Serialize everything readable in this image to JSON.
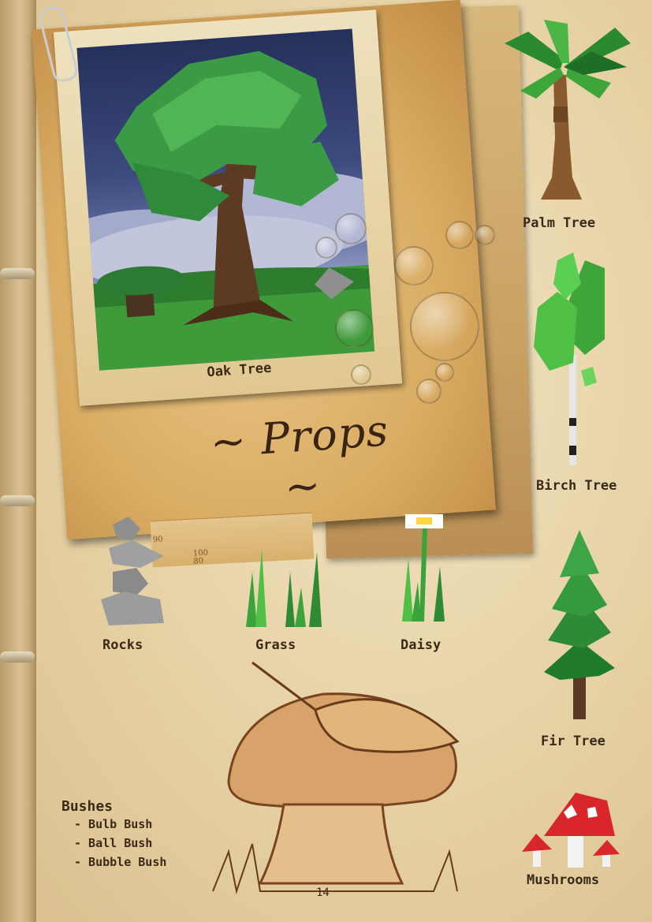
{
  "page": {
    "title": "~ Props ~",
    "page_number": "14"
  },
  "photo": {
    "caption": "Oak Tree"
  },
  "ruler": {
    "marks": [
      "90",
      "100",
      "80"
    ]
  },
  "props": {
    "palm_tree": "Palm Tree",
    "birch_tree": "Birch Tree",
    "fir_tree": "Fir Tree",
    "rocks": "Rocks",
    "grass": "Grass",
    "daisy": "Daisy",
    "mushrooms": "Mushrooms"
  },
  "bushes": {
    "title": "Bushes",
    "items": [
      "- Bulb Bush",
      "- Ball Bush",
      "- Bubble Bush"
    ]
  },
  "colors": {
    "paper": "#e9d6ad",
    "ink": "#3b2a19",
    "foliage": "#2f8f3a",
    "trunk": "#7a4e28",
    "mushroom_cap": "#d8262a"
  }
}
